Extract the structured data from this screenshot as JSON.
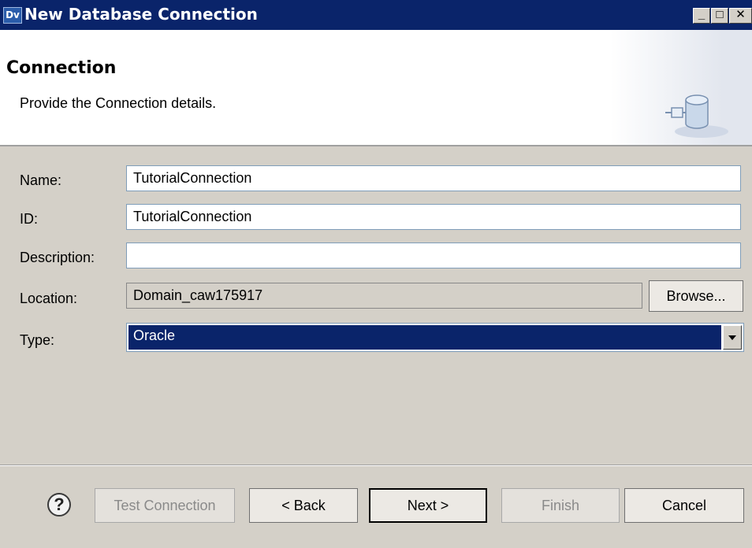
{
  "window": {
    "app_icon_text": "Dv",
    "title": "New Database Connection",
    "controls": {
      "minimize": "_",
      "maximize": "□",
      "close": "✕"
    }
  },
  "header": {
    "title": "Connection",
    "description": "Provide the Connection details.",
    "icon": "database-connection-icon"
  },
  "form": {
    "name": {
      "label": "Name:",
      "value": "TutorialConnection"
    },
    "id": {
      "label": "ID:",
      "value": "TutorialConnection"
    },
    "description": {
      "label": "Description:",
      "value": ""
    },
    "location": {
      "label": "Location:",
      "value": "Domain_caw175917",
      "browse_label": "Browse..."
    },
    "type": {
      "label": "Type:",
      "selected": "Oracle"
    }
  },
  "footer": {
    "help_icon": "?",
    "buttons": {
      "test_connection": "Test Connection",
      "back": "< Back",
      "next": "Next >",
      "finish": "Finish",
      "cancel": "Cancel"
    }
  }
}
